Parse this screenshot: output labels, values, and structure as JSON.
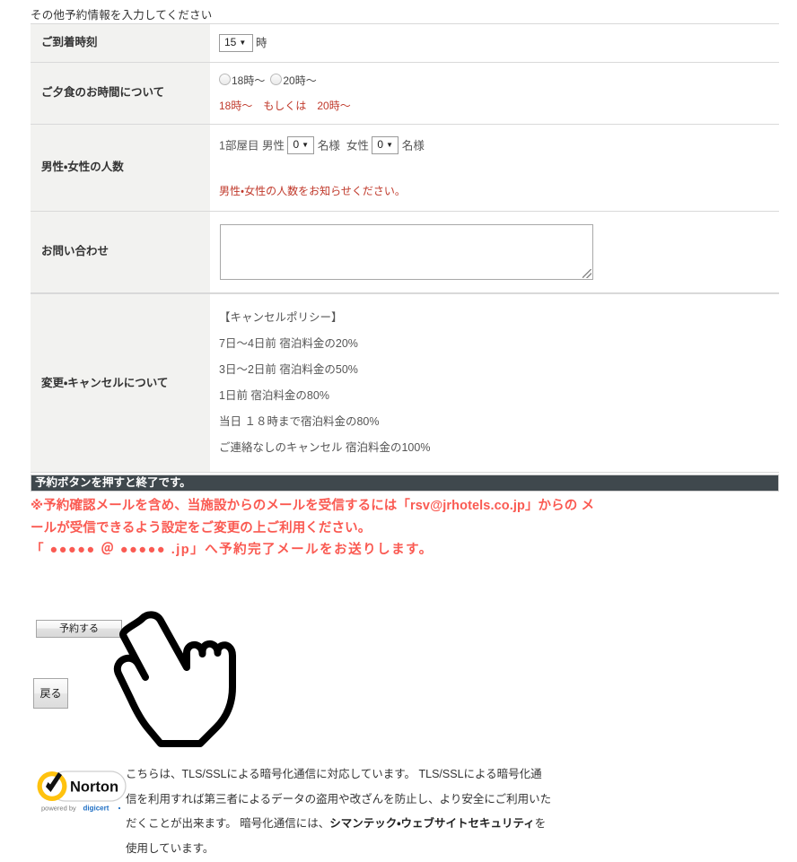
{
  "section": {
    "heading": "その他予約情報を入力してください"
  },
  "form": {
    "rows": [
      {
        "label": "ご到着時刻",
        "select_value": "15",
        "suffix": "時"
      },
      {
        "label": "ご夕食のお時間について",
        "radio1_label": "18時〜",
        "radio2_label": "20時〜",
        "note": "18時〜　もしくは　20時〜"
      },
      {
        "label": "男性・女性の人数",
        "prefix": "1部屋目",
        "male_label": "男性",
        "male_value": "0",
        "male_suffix": "名様",
        "female_label": "女性",
        "female_value": "0",
        "female_suffix": "名様",
        "note": "男性・女性の人数をお知らせください。"
      },
      {
        "label": "お問い合わせ",
        "textarea_value": "",
        "textarea_placeholder": ""
      }
    ]
  },
  "policy": {
    "label": "変更・キャンセルについて",
    "lines": [
      "【キャンセルポリシー】",
      "7日〜4日前 宿泊料金の20%",
      "3日〜2日前 宿泊料金の50%",
      "1日前 宿泊料金の80%",
      "当日 １８時まで宿泊料金の80%",
      "ご連絡なしのキャンセル 宿泊料金の100%"
    ]
  },
  "notice": {
    "bar_text": "予約ボタンを押すと終了です。",
    "red_line1": "※予約確認メールを含め、当施設からのメールを受信するには「rsv@jrhotels.co.jp」からの メ",
    "red_line2": "ールが受信できるよう設定をご変更の上ご利用ください。",
    "red_line3": "「 ●●●●● ＠ ●●●●● .jp」へ予約完了メールをお送りします。"
  },
  "buttons": {
    "reserve": "予約する",
    "back": "戻る"
  },
  "cursor": {
    "icon": "pointing-hand-cursor"
  },
  "ssl": {
    "badge_brand": "Norton",
    "badge_powered": "powered by",
    "badge_vendor": "digicert",
    "line1": "こちらは、TLS/SSLによる暗号化通信に対応しています。 TLS/SSLによる暗号化通",
    "line2": "信を利用すれば第三者によるデータの盗用や改ざんを防止し、より安全にご利用いた",
    "line3_a": "だくことが出来ます。 暗号化通信には、",
    "line3_b": "シマンテック・ウェブサイトセキュリティ",
    "line3_c": "を",
    "line4": "使用しています。"
  },
  "colors": {
    "accent_red": "#fa5a52",
    "notice_bar_bg": "#3f484d",
    "label_bg": "#f2f2f0",
    "border": "#d9d9d9",
    "note_red": "#c0392b",
    "norton_yellow": "#ffc20e",
    "digicert_blue": "#1f6fc4"
  }
}
